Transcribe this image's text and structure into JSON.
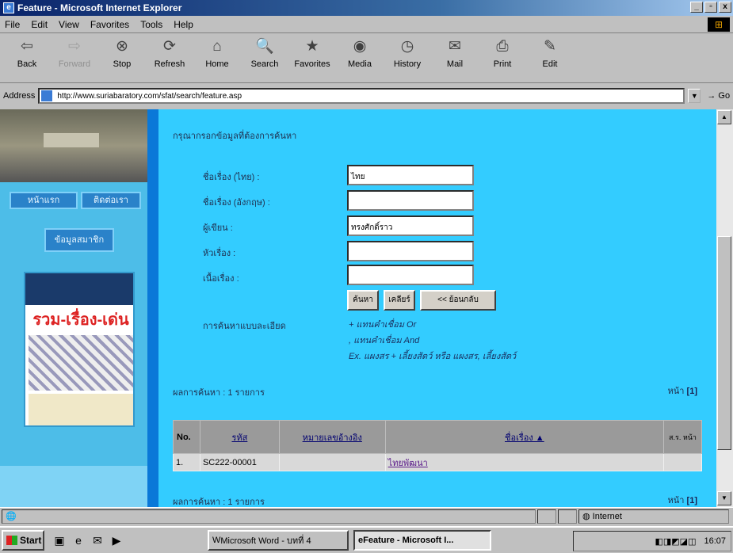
{
  "window": {
    "title": "Feature - Microsoft Internet Explorer",
    "min": "_",
    "max": "▫",
    "close": "x"
  },
  "menu": [
    "File",
    "Edit",
    "View",
    "Favorites",
    "Tools",
    "Help"
  ],
  "toolbar": [
    {
      "label": "Back",
      "icon": "⇦"
    },
    {
      "label": "Forward",
      "icon": "⇨"
    },
    {
      "label": "Stop",
      "icon": "⊗"
    },
    {
      "label": "Refresh",
      "icon": "⟳"
    },
    {
      "label": "Home",
      "icon": "⌂"
    },
    {
      "label": "Search",
      "icon": "🔍"
    },
    {
      "label": "Favorites",
      "icon": "★"
    },
    {
      "label": "Media",
      "icon": "◉"
    },
    {
      "label": "History",
      "icon": "◷"
    },
    {
      "label": "Mail",
      "icon": "✉"
    },
    {
      "label": "Print",
      "icon": "⎙"
    },
    {
      "label": "Edit",
      "icon": "✎"
    }
  ],
  "address": {
    "label": "Address",
    "url": "http://www.suriabaratory.com/sfat/search/feature.asp",
    "go": "Go"
  },
  "left": {
    "nav1": "หน้าแรก",
    "nav2": "ติดต่อเรา",
    "nav3": "ข้อมูลสมาชิก",
    "poster_title": "รวม-เรื่อง-เด่น"
  },
  "form": {
    "prompt": "กรุณากรอกข้อมูลที่ต้องการค้นหา",
    "fields": [
      {
        "label": "ชื่อเรื่อง (ไทย) :",
        "value": "ไทย"
      },
      {
        "label": "ชื่อเรื่อง (อังกฤษ) :",
        "value": ""
      },
      {
        "label": "ผู้เขียน :",
        "value": "ทรงศักดิ์ราว"
      },
      {
        "label": "หัวเรื่อง :",
        "value": ""
      },
      {
        "label": "เนื้อเรื่อง :",
        "value": ""
      }
    ],
    "btn_search": "ค้นหา",
    "btn_clear": "เคลียร์",
    "btn_back": "<< ย้อนกลับ",
    "hint_label": "การค้นหาแบบละเอียด",
    "hints": [
      "+ แทนคำเชื่อม Or",
      ", แทนคำเชื่อม And",
      "Ex. แผงสร + เลี้ยงสัตว์ หรือ แผงสร, เลี้ยงสัตว์"
    ]
  },
  "results": {
    "summary_top": "ผลการค้นหา : 1 รายการ",
    "summary_bottom": "ผลการค้นหา : 1 รายการ",
    "pages_label": "หน้า",
    "pages_value": "[1]",
    "headers": [
      "No.",
      "รหัส",
      "หมายเลขอ้างอิง",
      "ชื่อเรื่อง ▲",
      "ส.ร. หน้า"
    ],
    "rows": [
      {
        "no": "1.",
        "code": "SC222-00001",
        "ref": "",
        "title": "ไทยพัฒนา",
        "page": ""
      }
    ]
  },
  "status": {
    "text": "",
    "zone": "Internet"
  },
  "taskbar": {
    "start": "Start",
    "tasks": [
      "Microsoft Word - บทที่ 4",
      "Feature - Microsoft I..."
    ],
    "clock": "16:07"
  }
}
